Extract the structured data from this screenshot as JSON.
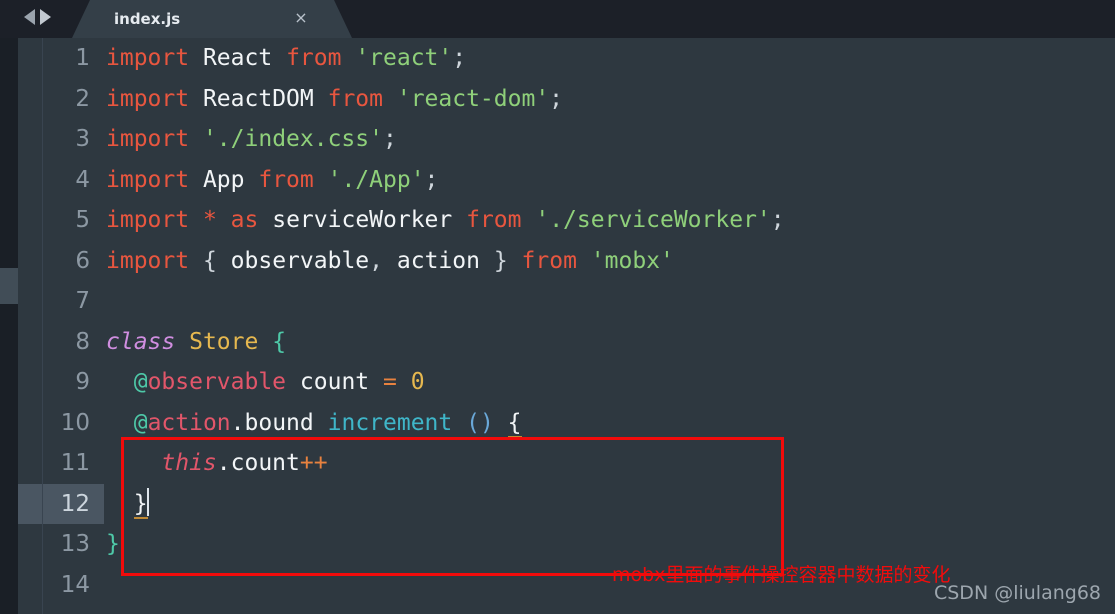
{
  "window": {
    "app": "Sublime Text",
    "background_color": "#2e3840",
    "tabbar_color": "#1c2028"
  },
  "tabbar": {
    "nav_back_icon": "triangle-left-icon",
    "nav_forward_icon": "triangle-right-icon",
    "tabs": [
      {
        "title": "index.js",
        "active": true,
        "close_label": "×"
      }
    ]
  },
  "editor": {
    "active_line": 12,
    "cursor_line": 12,
    "gutter": {
      "line_numbers": [
        "1",
        "2",
        "3",
        "4",
        "5",
        "6",
        "7",
        "8",
        "9",
        "10",
        "11",
        "12",
        "13",
        "14"
      ]
    },
    "lines": [
      {
        "num": "1",
        "text": "import React from 'react';",
        "tokens": [
          {
            "t": "import",
            "c": "t-kw"
          },
          {
            "t": " ",
            "c": "t-white"
          },
          {
            "t": "React",
            "c": "t-ident"
          },
          {
            "t": " ",
            "c": "t-white"
          },
          {
            "t": "from",
            "c": "t-kw"
          },
          {
            "t": " ",
            "c": "t-white"
          },
          {
            "t": "'react'",
            "c": "t-str"
          },
          {
            "t": ";",
            "c": "t-punc"
          }
        ]
      },
      {
        "num": "2",
        "text": "import ReactDOM from 'react-dom';",
        "tokens": [
          {
            "t": "import",
            "c": "t-kw"
          },
          {
            "t": " ",
            "c": "t-white"
          },
          {
            "t": "ReactDOM",
            "c": "t-ident"
          },
          {
            "t": " ",
            "c": "t-white"
          },
          {
            "t": "from",
            "c": "t-kw"
          },
          {
            "t": " ",
            "c": "t-white"
          },
          {
            "t": "'react-dom'",
            "c": "t-str"
          },
          {
            "t": ";",
            "c": "t-punc"
          }
        ]
      },
      {
        "num": "3",
        "text": "import './index.css';",
        "tokens": [
          {
            "t": "import",
            "c": "t-kw"
          },
          {
            "t": " ",
            "c": "t-white"
          },
          {
            "t": "'./index.css'",
            "c": "t-str"
          },
          {
            "t": ";",
            "c": "t-punc"
          }
        ]
      },
      {
        "num": "4",
        "text": "import App from './App';",
        "tokens": [
          {
            "t": "import",
            "c": "t-kw"
          },
          {
            "t": " ",
            "c": "t-white"
          },
          {
            "t": "App",
            "c": "t-ident"
          },
          {
            "t": " ",
            "c": "t-white"
          },
          {
            "t": "from",
            "c": "t-kw"
          },
          {
            "t": " ",
            "c": "t-white"
          },
          {
            "t": "'./App'",
            "c": "t-str"
          },
          {
            "t": ";",
            "c": "t-punc"
          }
        ]
      },
      {
        "num": "5",
        "text": "import * as serviceWorker from './serviceWorker';",
        "tokens": [
          {
            "t": "import",
            "c": "t-kw"
          },
          {
            "t": " ",
            "c": "t-white"
          },
          {
            "t": "*",
            "c": "t-star"
          },
          {
            "t": " ",
            "c": "t-white"
          },
          {
            "t": "as",
            "c": "t-kw"
          },
          {
            "t": " ",
            "c": "t-white"
          },
          {
            "t": "serviceWorker",
            "c": "t-ident"
          },
          {
            "t": " ",
            "c": "t-white"
          },
          {
            "t": "from",
            "c": "t-kw"
          },
          {
            "t": " ",
            "c": "t-white"
          },
          {
            "t": "'./serviceWorker'",
            "c": "t-str"
          },
          {
            "t": ";",
            "c": "t-punc"
          }
        ]
      },
      {
        "num": "6",
        "text": "import { observable, action } from 'mobx'",
        "tokens": [
          {
            "t": "import",
            "c": "t-kw"
          },
          {
            "t": " ",
            "c": "t-white"
          },
          {
            "t": "{",
            "c": "t-punc"
          },
          {
            "t": " ",
            "c": "t-white"
          },
          {
            "t": "observable",
            "c": "t-ident"
          },
          {
            "t": ",",
            "c": "t-punc"
          },
          {
            "t": " ",
            "c": "t-white"
          },
          {
            "t": "action",
            "c": "t-ident"
          },
          {
            "t": " ",
            "c": "t-white"
          },
          {
            "t": "}",
            "c": "t-punc"
          },
          {
            "t": " ",
            "c": "t-white"
          },
          {
            "t": "from",
            "c": "t-kw"
          },
          {
            "t": " ",
            "c": "t-white"
          },
          {
            "t": "'mobx'",
            "c": "t-str"
          }
        ]
      },
      {
        "num": "7",
        "text": "",
        "tokens": []
      },
      {
        "num": "8",
        "text": "class Store {",
        "tokens": [
          {
            "t": "class",
            "c": "t-classkw"
          },
          {
            "t": " ",
            "c": "t-white"
          },
          {
            "t": "Store",
            "c": "t-classname"
          },
          {
            "t": " ",
            "c": "t-white"
          },
          {
            "t": "{",
            "c": "t-brace"
          }
        ]
      },
      {
        "num": "9",
        "text": "  @observable count = 0",
        "tokens": [
          {
            "t": "  ",
            "c": "t-white"
          },
          {
            "t": "@",
            "c": "t-at"
          },
          {
            "t": "observable",
            "c": "t-deco"
          },
          {
            "t": " ",
            "c": "t-white"
          },
          {
            "t": "count",
            "c": "t-white"
          },
          {
            "t": " ",
            "c": "t-white"
          },
          {
            "t": "=",
            "c": "t-op"
          },
          {
            "t": " ",
            "c": "t-white"
          },
          {
            "t": "0",
            "c": "t-num"
          }
        ]
      },
      {
        "num": "10",
        "text": "  @action.bound increment () {",
        "tokens": [
          {
            "t": "  ",
            "c": "t-white"
          },
          {
            "t": "@",
            "c": "t-at"
          },
          {
            "t": "action",
            "c": "t-deco"
          },
          {
            "t": ".",
            "c": "t-white"
          },
          {
            "t": "bound",
            "c": "t-white"
          },
          {
            "t": " ",
            "c": "t-white"
          },
          {
            "t": "increment",
            "c": "t-fn"
          },
          {
            "t": " ",
            "c": "t-white"
          },
          {
            "t": "()",
            "c": "t-paren"
          },
          {
            "t": " ",
            "c": "t-white"
          },
          {
            "t": "{",
            "c": "t-matchbrace"
          }
        ]
      },
      {
        "num": "11",
        "text": "    this.count++",
        "tokens": [
          {
            "t": "    ",
            "c": "t-white"
          },
          {
            "t": "this",
            "c": "t-this"
          },
          {
            "t": ".",
            "c": "t-white"
          },
          {
            "t": "count",
            "c": "t-white"
          },
          {
            "t": "++",
            "c": "t-op"
          }
        ]
      },
      {
        "num": "12",
        "text": "  }",
        "tokens": [
          {
            "t": "  ",
            "c": "t-white"
          },
          {
            "t": "}",
            "c": "t-matchbrace"
          }
        ],
        "has_caret": true
      },
      {
        "num": "13",
        "text": "}",
        "tokens": [
          {
            "t": "}",
            "c": "t-brace"
          }
        ]
      },
      {
        "num": "14",
        "text": "",
        "tokens": []
      }
    ]
  },
  "annotations": {
    "highlight_box": {
      "color": "#f20b0b",
      "covers_lines": [
        "10",
        "11",
        "12"
      ]
    },
    "note_text": "mobx里面的事件操控容器中数据的变化",
    "note_color": "#f20b0b",
    "watermark_text": "CSDN @liulang68",
    "watermark_color": "#9da6ae"
  }
}
